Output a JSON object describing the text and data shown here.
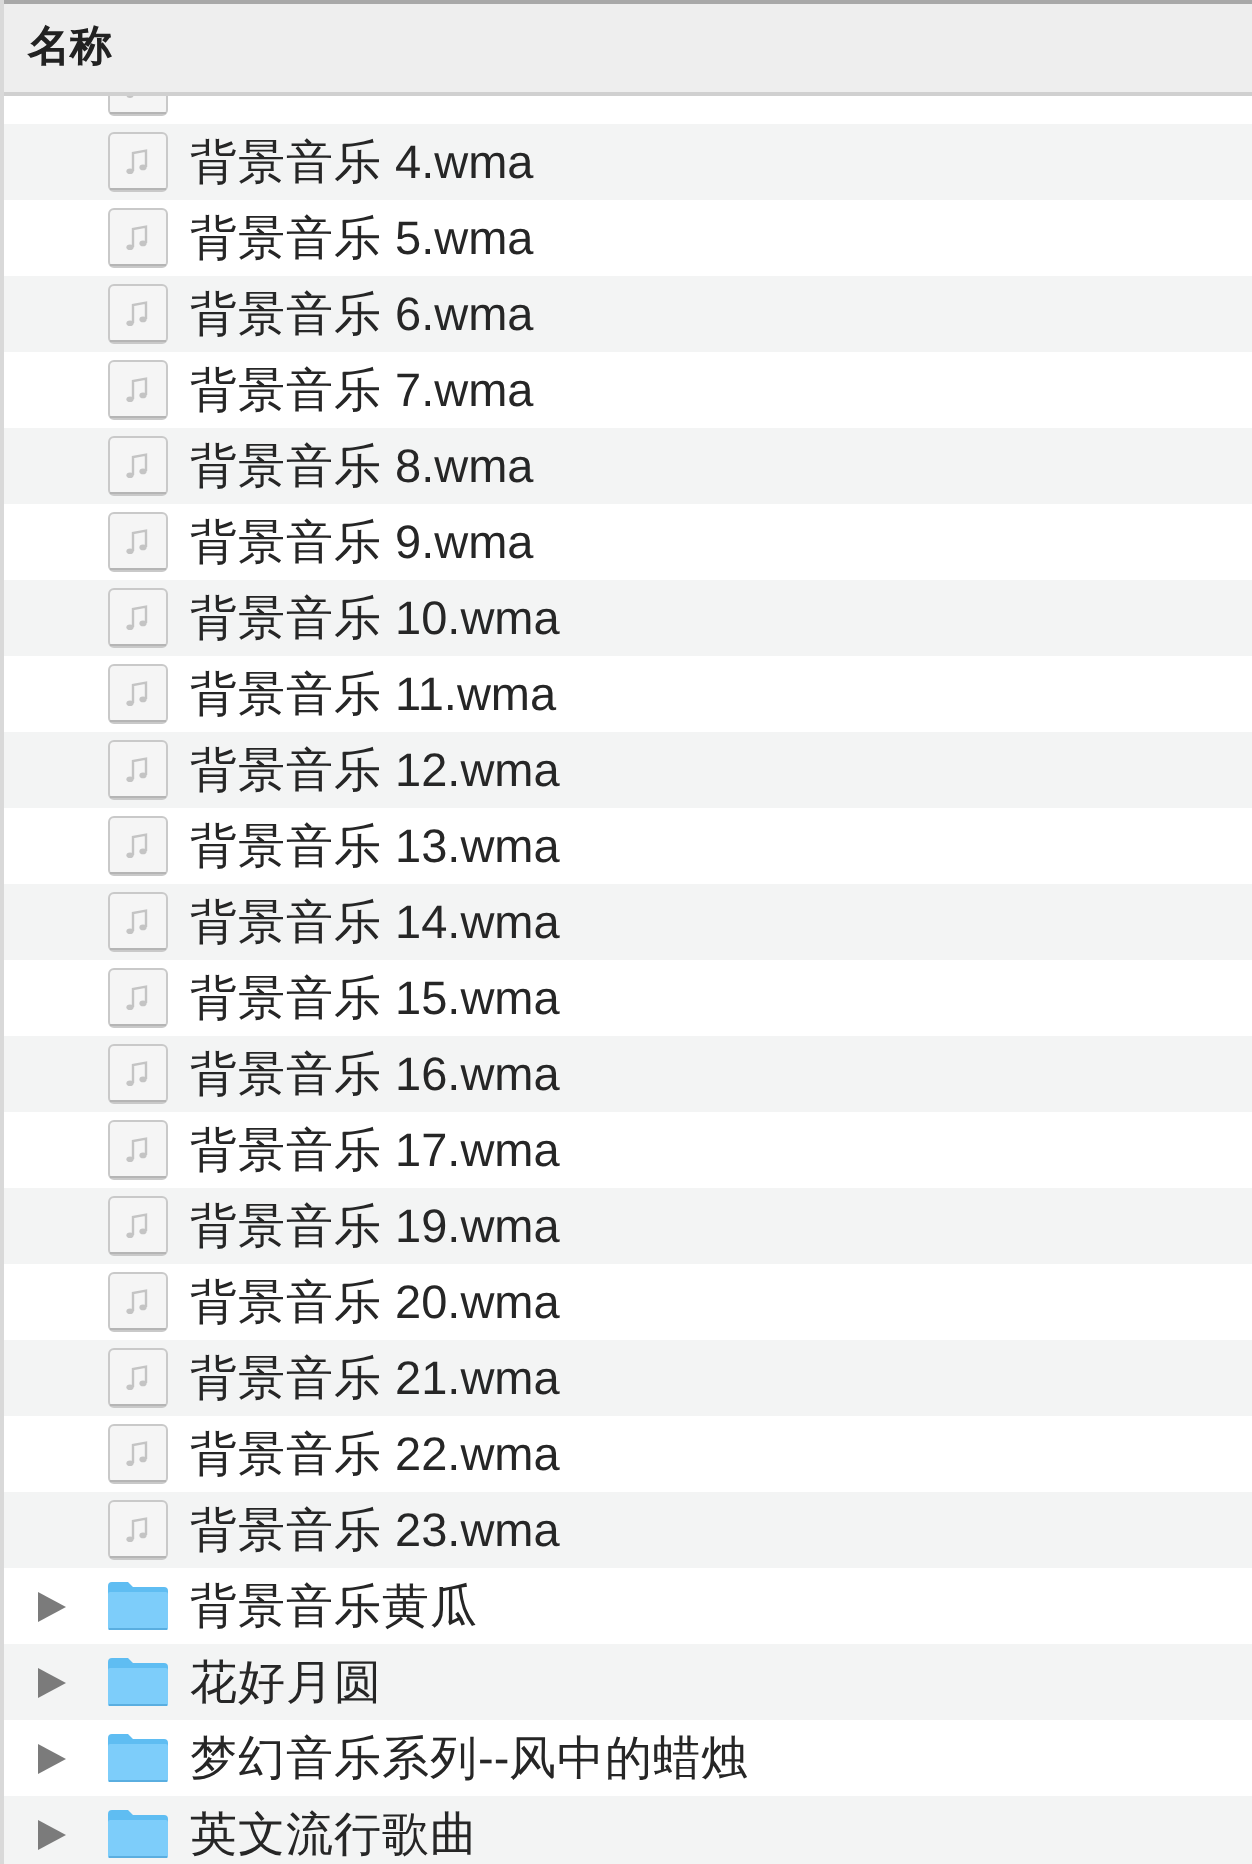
{
  "table": {
    "columns": [
      "名称"
    ],
    "rows": [
      {
        "kind": "file"
      },
      {
        "kind": "file",
        "name": "背景音乐 4.wma"
      },
      {
        "kind": "file",
        "name": "背景音乐 5.wma"
      },
      {
        "kind": "file",
        "name": "背景音乐 6.wma"
      },
      {
        "kind": "file",
        "name": "背景音乐 7.wma"
      },
      {
        "kind": "file",
        "name": "背景音乐 8.wma"
      },
      {
        "kind": "file",
        "name": "背景音乐 9.wma"
      },
      {
        "kind": "file",
        "name": "背景音乐 10.wma"
      },
      {
        "kind": "file",
        "name": "背景音乐 11.wma"
      },
      {
        "kind": "file",
        "name": "背景音乐 12.wma"
      },
      {
        "kind": "file",
        "name": "背景音乐 13.wma"
      },
      {
        "kind": "file",
        "name": "背景音乐 14.wma"
      },
      {
        "kind": "file",
        "name": "背景音乐 15.wma"
      },
      {
        "kind": "file",
        "name": "背景音乐 16.wma"
      },
      {
        "kind": "file",
        "name": "背景音乐 17.wma"
      },
      {
        "kind": "file",
        "name": "背景音乐 19.wma"
      },
      {
        "kind": "file",
        "name": "背景音乐 20.wma"
      },
      {
        "kind": "file",
        "name": "背景音乐 21.wma"
      },
      {
        "kind": "file",
        "name": "背景音乐 22.wma"
      },
      {
        "kind": "file",
        "name": "背景音乐 23.wma"
      },
      {
        "kind": "folder",
        "name": "背景音乐黄瓜",
        "expanded": false
      },
      {
        "kind": "folder",
        "name": "花好月圆",
        "expanded": false
      },
      {
        "kind": "folder",
        "name": "梦幻音乐系列--风中的蜡烛",
        "expanded": false
      },
      {
        "kind": "folder",
        "name": "英文流行歌曲",
        "expanded": false
      }
    ]
  }
}
